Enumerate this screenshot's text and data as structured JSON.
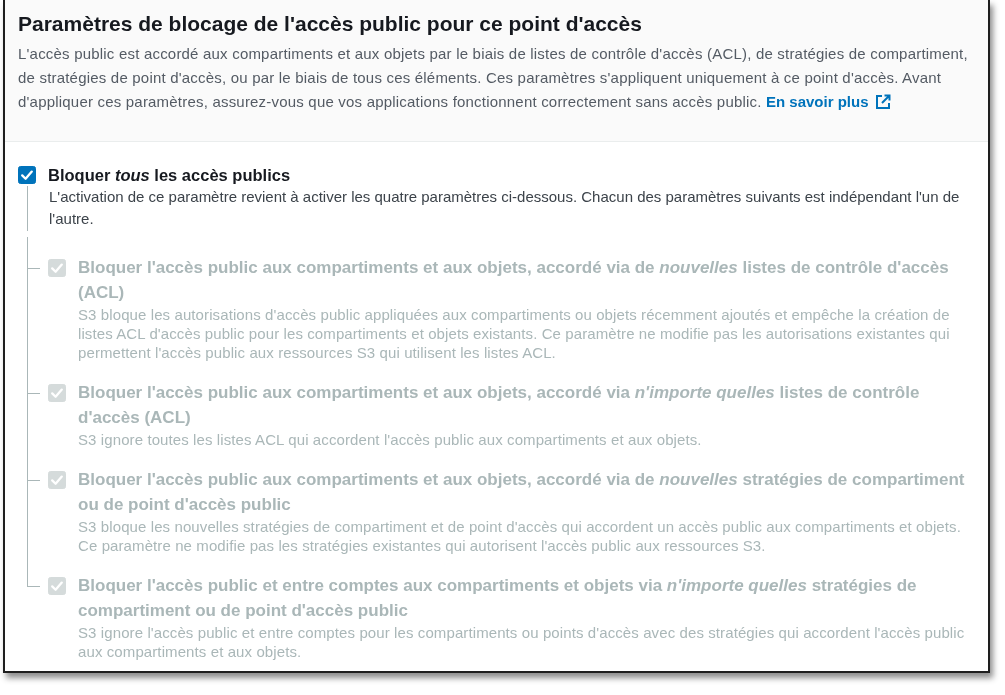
{
  "header": {
    "title": "Paramètres de blocage de l'accès public pour ce point d'accès",
    "description": "L'accès public est accordé aux compartiments et aux objets par le biais de listes de contrôle d'accès (ACL), de stratégies de compartiment, de stratégies de point d'accès, ou par le biais de tous ces éléments. Ces paramètres s'appliquent uniquement à ce point d'accès. Avant d'appliquer ces paramètres, assurez-vous que vos applications fonctionnent correctement sans accès public.",
    "link": {
      "label": "En savoir plus"
    }
  },
  "master": {
    "label": "Bloquer *tous* les accès publics",
    "checked": true,
    "description": "L'activation de ce paramètre revient à activer les quatre paramètres ci-dessous. Chacun des paramètres suivants est indépendant l'un de l'autre."
  },
  "settings": [
    {
      "label": "Bloquer l'accès public aux compartiments et aux objets, accordé via de *nouvelles* listes de contrôle d'accès (ACL)",
      "description": "S3 bloque les autorisations d'accès public appliquées aux compartiments ou objets récemment ajoutés et empêche la création de listes ACL d'accès public pour les compartiments et objets existants. Ce paramètre ne modifie pas les autorisations existantes qui permettent l'accès public aux ressources S3 qui utilisent les listes ACL.",
      "checked": true,
      "disabled": true
    },
    {
      "label": "Bloquer l'accès public aux compartiments et aux objets, accordé via *n'importe quelles* listes de contrôle d'accès (ACL)",
      "description": "S3 ignore toutes les listes ACL qui accordent l'accès public aux compartiments et aux objets.",
      "checked": true,
      "disabled": true
    },
    {
      "label": "Bloquer l'accès public aux compartiments et aux objets, accordé via de *nouvelles* stratégies de compartiment ou de point d'accès public",
      "description": "S3 bloque les nouvelles stratégies de compartiment et de point d'accès qui accordent un accès public aux compartiments et objets. Ce paramètre ne modifie pas les stratégies existantes qui autorisent l'accès public aux ressources S3.",
      "checked": true,
      "disabled": true
    },
    {
      "label": "Bloquer l'accès public et entre comptes aux compartiments et objets via *n'importe quelles* stratégies de compartiment ou de point d'accès public",
      "description": "S3 ignore l'accès public et entre comptes pour les compartiments ou points d'accès avec des stratégies qui accordent l'accès public aux compartiments et aux objets.",
      "checked": true,
      "disabled": true
    }
  ]
}
